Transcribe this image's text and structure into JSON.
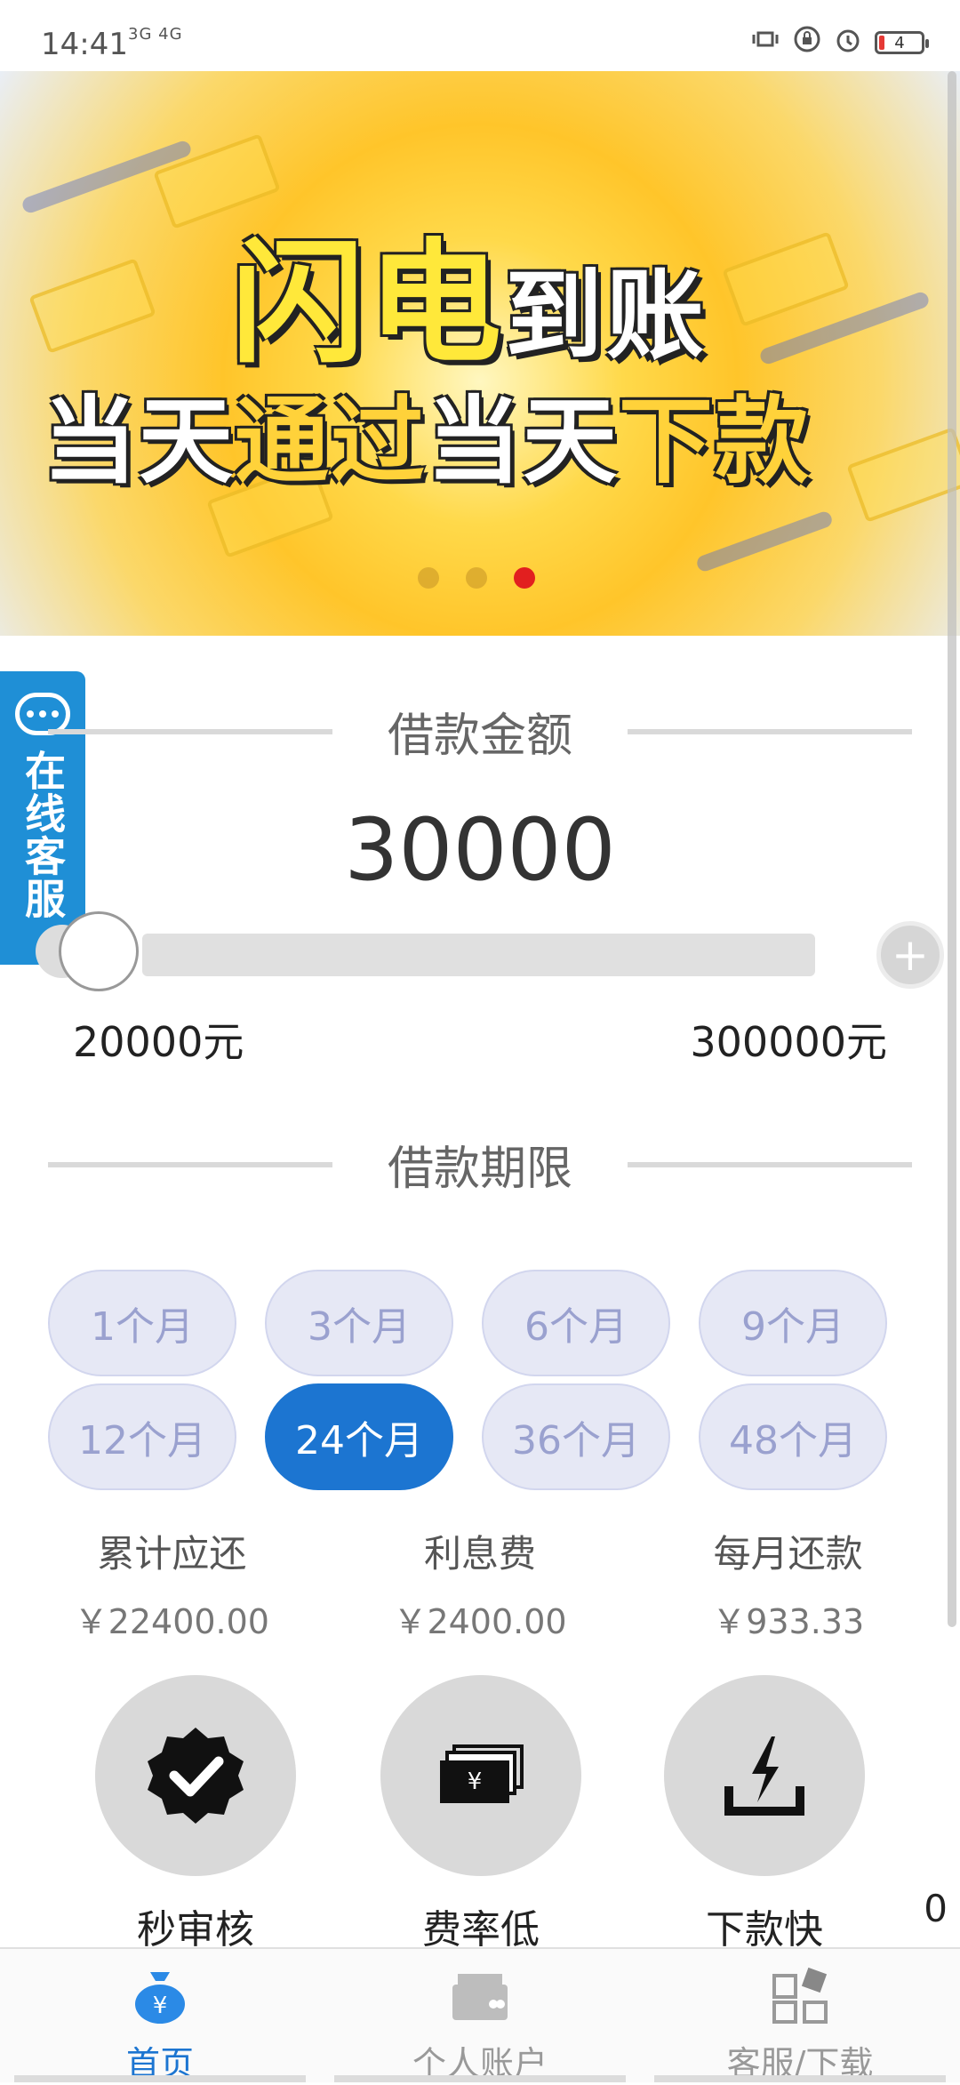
{
  "status_bar": {
    "time": "14:41",
    "signal": "3G 4G",
    "battery": "4"
  },
  "banner": {
    "title_line1_big": "闪电",
    "title_line1_small": "到账",
    "title_line2_a": "当天",
    "title_line2_b": "通过",
    "title_line2_c": "当天",
    "title_line2_d": "下款",
    "active_slide": 3,
    "slide_count": 3
  },
  "service_tab": {
    "label": "在线客服"
  },
  "amount": {
    "heading": "借款金额",
    "value": "30000",
    "min_label": "20000元",
    "max_label": "300000元",
    "plus": "+"
  },
  "term": {
    "heading": "借款期限",
    "options": [
      "1个月",
      "3个月",
      "6个月",
      "9个月",
      "12个月",
      "24个月",
      "36个月",
      "48个月"
    ],
    "selected_index": 5
  },
  "summary": [
    {
      "label": "累计应还",
      "value": "￥22400.00"
    },
    {
      "label": "利息费",
      "value": "￥2400.00"
    },
    {
      "label": "每月还款",
      "value": "￥933.33"
    }
  ],
  "features": [
    {
      "name": "秒审核",
      "icon": "badge-check-icon"
    },
    {
      "name": "费率低",
      "icon": "cash-icon"
    },
    {
      "name": "下款快",
      "icon": "lightning-download-icon"
    }
  ],
  "floating_counter": "0",
  "bottom_nav": [
    {
      "label": "首页",
      "icon": "money-bag-icon",
      "active": true
    },
    {
      "label": "个人账户",
      "icon": "wallet-icon",
      "active": false
    },
    {
      "label": "客服/下载",
      "icon": "apps-icon",
      "active": false
    }
  ],
  "colors": {
    "primary": "#1c75d1",
    "service_tab": "#1f8fd6",
    "active_dot": "#e21f1f"
  }
}
